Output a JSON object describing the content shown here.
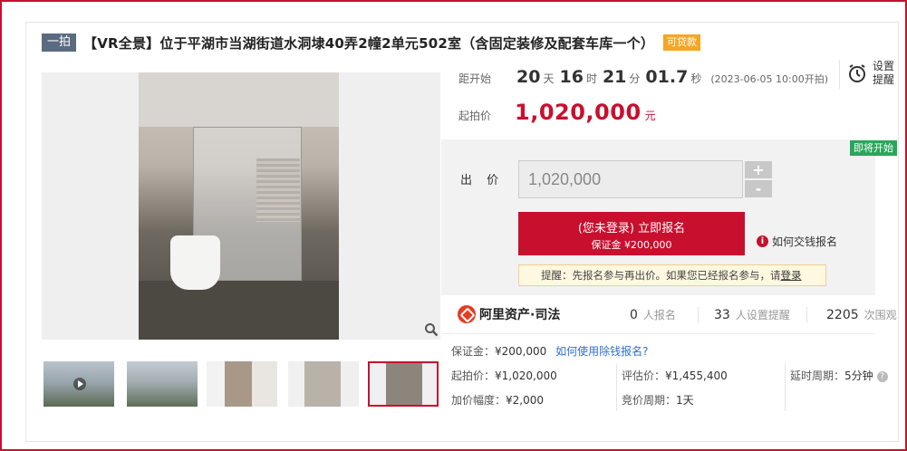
{
  "header": {
    "tag": "一拍",
    "title": "【VR全景】位于平湖市当湖街道水洞埭40弄2幢2单元502室（含固定装修及配套车库一个）",
    "loan_badge": "可贷款"
  },
  "countdown": {
    "label": "距开始",
    "days": "20",
    "days_unit": "天",
    "hours": "16",
    "hours_unit": "时",
    "minutes": "21",
    "minutes_unit": "分",
    "seconds": "01.7",
    "seconds_unit": "秒",
    "start_time": "(2023-06-05 10:00开拍)"
  },
  "remind": {
    "label": "设置提醒",
    "icon": "alarm-clock-icon"
  },
  "start_price": {
    "label": "起拍价",
    "value": "1,020,000",
    "unit": "元"
  },
  "bid": {
    "status_badge": "即将开始",
    "label": "出 价",
    "input_value": "1,020,000",
    "plus": "+",
    "minus": "-",
    "signup_main": "(您未登录) 立即报名",
    "signup_sub": "保证金 ¥200,000",
    "howto": "如何交钱报名",
    "tip_prefix": "提醒：先报名参与再出价。如果您已经报名参与，请",
    "tip_login": "登录"
  },
  "stats": {
    "platform": "阿里资产·司法",
    "signups": "0",
    "signups_unit": "人报名",
    "reminders": "33",
    "reminders_unit": "人设置提醒",
    "views": "2205",
    "views_unit": "次围观"
  },
  "details": {
    "deposit_label": "保证金：",
    "deposit_value": "¥200,000",
    "deposit_link": "如何使用除钱报名?",
    "start_price_label": "起拍价：",
    "start_price_value": "¥1,020,000",
    "appraisal_label": "评估价：",
    "appraisal_value": "¥1,455,400",
    "delay_label": "延时周期：",
    "delay_value": "5分钟",
    "increment_label": "加价幅度：",
    "increment_value": "¥2,000",
    "cycle_label": "竞价周期：",
    "cycle_value": "1天"
  },
  "colors": {
    "accent": "#c8102e",
    "badge_green": "#2aa65a",
    "loan_orange": "#f5a623",
    "link_blue": "#2e6fd0"
  }
}
